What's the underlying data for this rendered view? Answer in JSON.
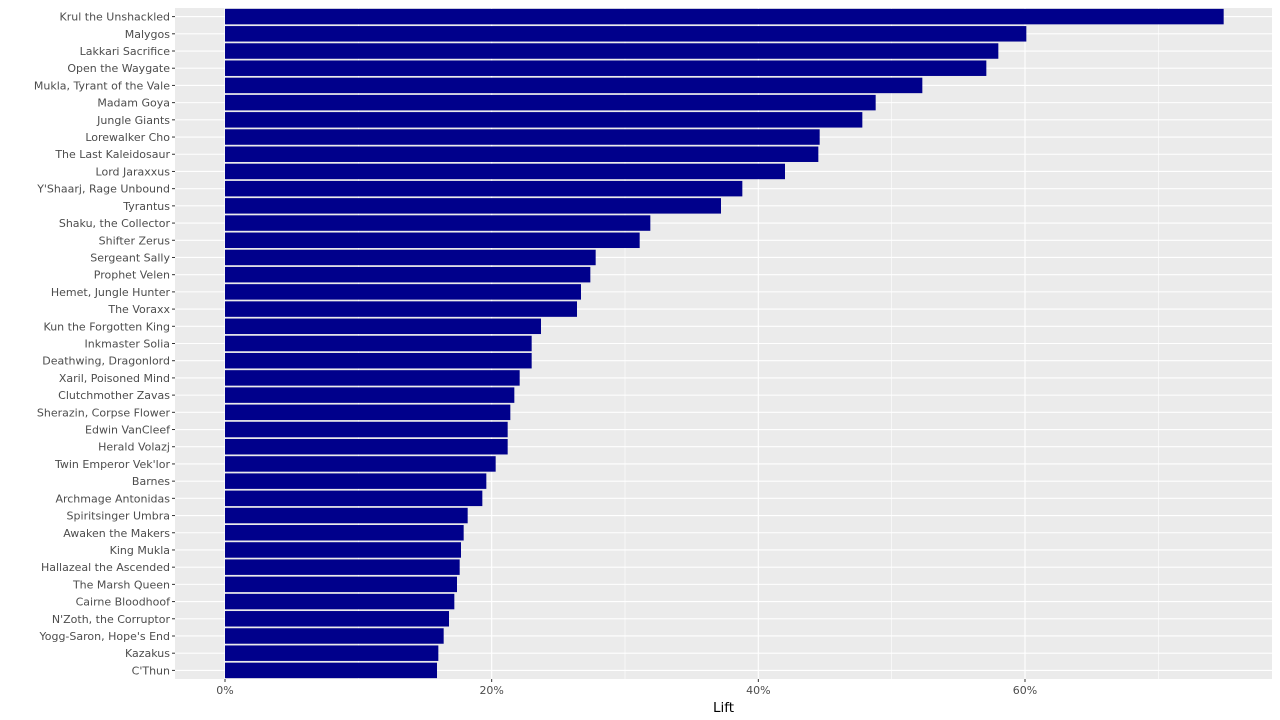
{
  "chart_data": {
    "type": "bar",
    "orientation": "horizontal",
    "title": "",
    "xlabel": "Lift",
    "ylabel": "",
    "xlim": [
      -3.75,
      78.75
    ],
    "xticks": [
      0,
      20,
      40,
      60
    ],
    "xtick_labels": [
      "0%",
      "20%",
      "40%",
      "60%"
    ],
    "grid": true,
    "bar_color": "#00008B",
    "panel_color": "#EBEBEB",
    "categories": [
      "Krul the Unshackled",
      "Malygos",
      "Lakkari Sacrifice",
      "Open the Waygate",
      "Mukla, Tyrant of the Vale",
      "Madam Goya",
      "Jungle Giants",
      "Lorewalker Cho",
      "The Last Kaleidosaur",
      "Lord Jaraxxus",
      "Y'Shaarj, Rage Unbound",
      "Tyrantus",
      "Shaku, the Collector",
      "Shifter Zerus",
      "Sergeant Sally",
      "Prophet Velen",
      "Hemet, Jungle Hunter",
      "The Voraxx",
      "Kun the Forgotten King",
      "Inkmaster Solia",
      "Deathwing, Dragonlord",
      "Xaril, Poisoned Mind",
      "Clutchmother Zavas",
      "Sherazin, Corpse Flower",
      "Edwin VanCleef",
      "Herald Volazj",
      "Twin Emperor Vek'lor",
      "Barnes",
      "Archmage Antonidas",
      "Spiritsinger Umbra",
      "Awaken the Makers",
      "King Mukla",
      "Hallazeal the Ascended",
      "The Marsh Queen",
      "Cairne Bloodhoof",
      "N'Zoth, the Corruptor",
      "Yogg-Saron, Hope's End",
      "Kazakus",
      "C'Thun"
    ],
    "values": [
      74.9,
      60.1,
      58.0,
      57.1,
      52.3,
      48.8,
      47.8,
      44.6,
      44.5,
      42.0,
      38.8,
      37.2,
      31.9,
      31.1,
      27.8,
      27.4,
      26.7,
      26.4,
      23.7,
      23.0,
      23.0,
      22.1,
      21.7,
      21.4,
      21.2,
      21.2,
      20.3,
      19.6,
      19.3,
      18.2,
      17.9,
      17.7,
      17.6,
      17.4,
      17.2,
      16.8,
      16.4,
      16.0,
      15.9
    ]
  }
}
